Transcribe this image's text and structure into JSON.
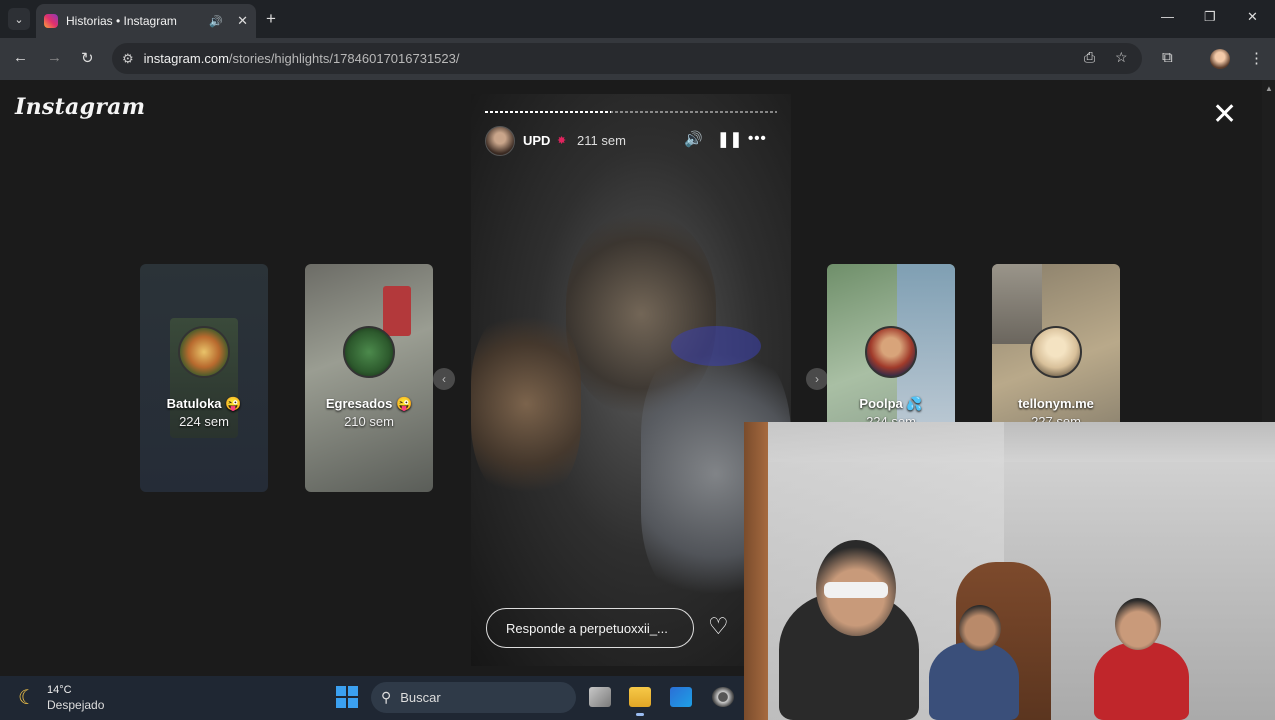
{
  "browser": {
    "tab_title": "Historias • Instagram",
    "url_host": "instagram.com",
    "url_path": "/stories/highlights/17846017016731523/"
  },
  "page": {
    "logo": "Instagram"
  },
  "cards": [
    {
      "name": "Batuloka 😜",
      "time": "224 sem"
    },
    {
      "name": "Egresados 😜",
      "time": "210 sem"
    },
    {
      "name": "Poolpa 💦",
      "time": "224 sem"
    },
    {
      "name": "tellonym.me",
      "time": "227 sem"
    }
  ],
  "story": {
    "user": "UPD",
    "time": "211 sem",
    "reply_placeholder": "Responde a perpetuoxxii_...",
    "progress": 0.43
  },
  "taskbar": {
    "temp": "14°C",
    "condition": "Despejado",
    "search": "Buscar"
  },
  "icons": [
    "tab-menu-icon",
    "mute-icon",
    "close-icon",
    "new-tab-icon",
    "back-icon",
    "forward-icon",
    "reload-icon",
    "site-info-icon",
    "install-icon",
    "star-icon",
    "extensions-icon",
    "menu-icon",
    "volume-icon",
    "pause-icon",
    "more-icon",
    "heart-icon",
    "moon-icon",
    "search-icon",
    "windows-icon"
  ]
}
